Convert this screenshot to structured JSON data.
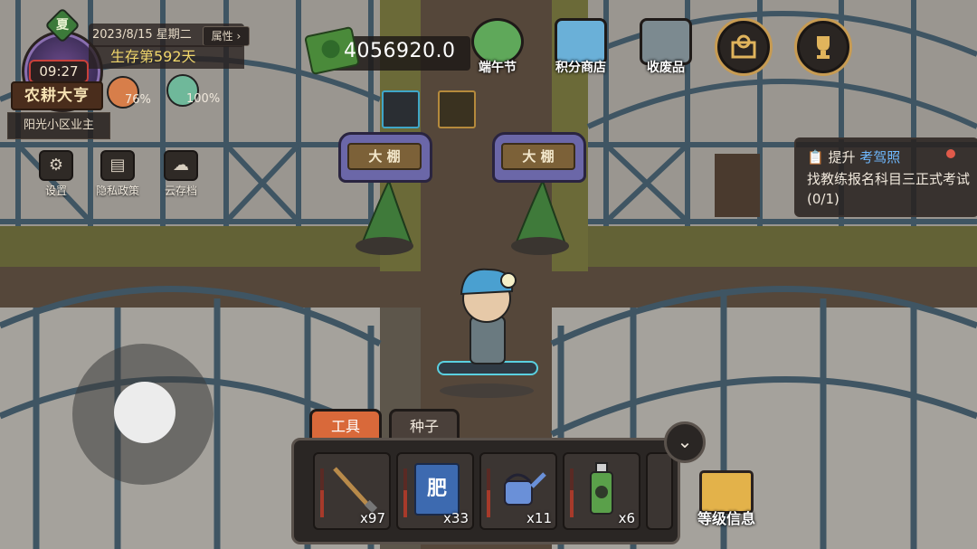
{
  "hud": {
    "season": "夏",
    "clock_time": "09:27",
    "game_title": "农耕大亨",
    "date": "2023/8/15 星期二",
    "attributes_label": "属性",
    "survival_days": "生存第592天",
    "food_percent": "76%",
    "health_percent": "100%",
    "location": "阳光小区业主"
  },
  "utility_buttons": [
    {
      "label": "设置",
      "icon": "gear-icon"
    },
    {
      "label": "隐私政策",
      "icon": "document-icon"
    },
    {
      "label": "云存档",
      "icon": "cloud-icon"
    }
  ],
  "money": "4056920.0",
  "top_buttons": [
    {
      "label": "端午节",
      "icon": "dragon-boat-festival-icon"
    },
    {
      "label": "积分商店",
      "icon": "points-shop-icon"
    },
    {
      "label": "收废品",
      "icon": "scrap-collect-icon"
    }
  ],
  "round_buttons": [
    {
      "icon": "map-pin-icon"
    },
    {
      "icon": "trophy-icon"
    }
  ],
  "buffs": [
    {
      "icon": "running-speed-icon"
    },
    {
      "icon": "coin-stack-icon"
    }
  ],
  "greenhouse_signs": [
    "大 棚",
    "大 棚"
  ],
  "quest": {
    "head_prefix": "提升",
    "head_highlight": "考驾照",
    "body": "找教练报名科目三正式考试(0/1)"
  },
  "toolbar": {
    "tabs": [
      "工具",
      "种子"
    ],
    "active_tab": "工具",
    "slots": [
      {
        "item": "hoe",
        "count": "x97"
      },
      {
        "item": "fertilizer",
        "label": "肥",
        "count": "x33"
      },
      {
        "item": "watering-can",
        "count": "x11"
      },
      {
        "item": "pesticide",
        "count": "x6"
      }
    ]
  },
  "level_info_label": "等级信息",
  "colors": {
    "accent": "#d9693a",
    "gold": "#c79b52",
    "quest_highlight": "#6fb9ff"
  }
}
